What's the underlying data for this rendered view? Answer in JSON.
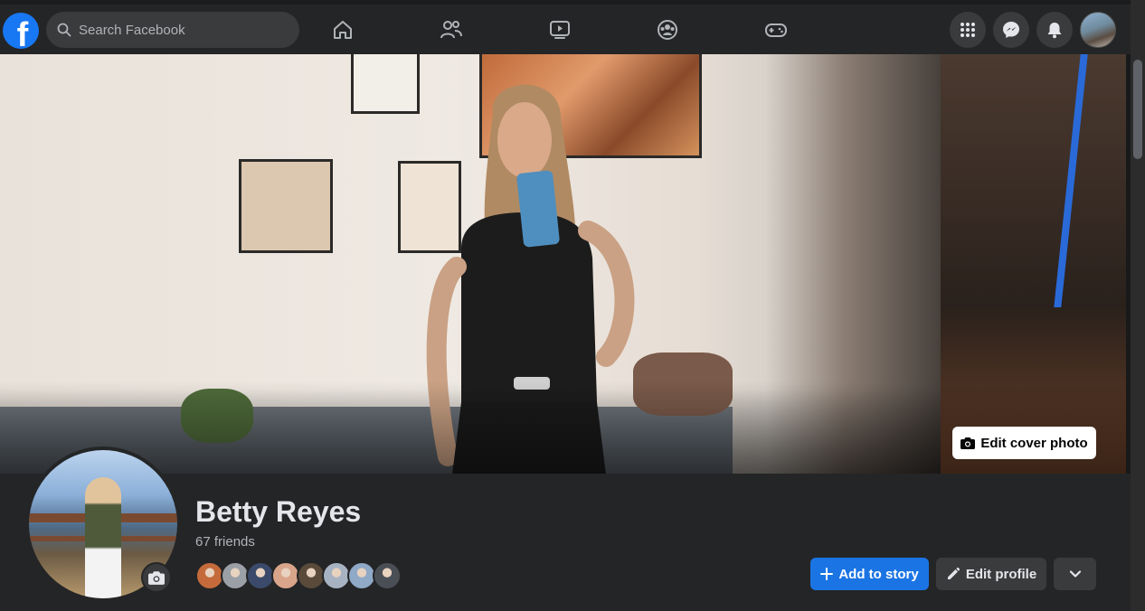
{
  "topbar": {
    "logo": "f",
    "search": {
      "placeholder": "Search Facebook"
    },
    "nav_icons": [
      "home-icon",
      "friends-icon",
      "watch-icon",
      "groups-icon",
      "gaming-icon"
    ],
    "right_icons": [
      "menu-grid-icon",
      "messenger-icon",
      "notifications-icon"
    ]
  },
  "cover": {
    "edit_label": "Edit cover photo"
  },
  "profile": {
    "name": "Betty Reyes",
    "friends_count": "67 friends",
    "friend_avatar_colors": [
      "#c56b3b",
      "#9aa0a6",
      "#3b4a6b",
      "#d9a58a",
      "#5a4a3a",
      "#a7b3c2",
      "#8fa9c7",
      "#4a4e55"
    ]
  },
  "actions": {
    "add_story": "Add to story",
    "edit_profile": "Edit profile"
  },
  "colors": {
    "accent": "#1b74e4",
    "topbar_bg": "#242526",
    "button_gray": "#3a3b3c"
  }
}
